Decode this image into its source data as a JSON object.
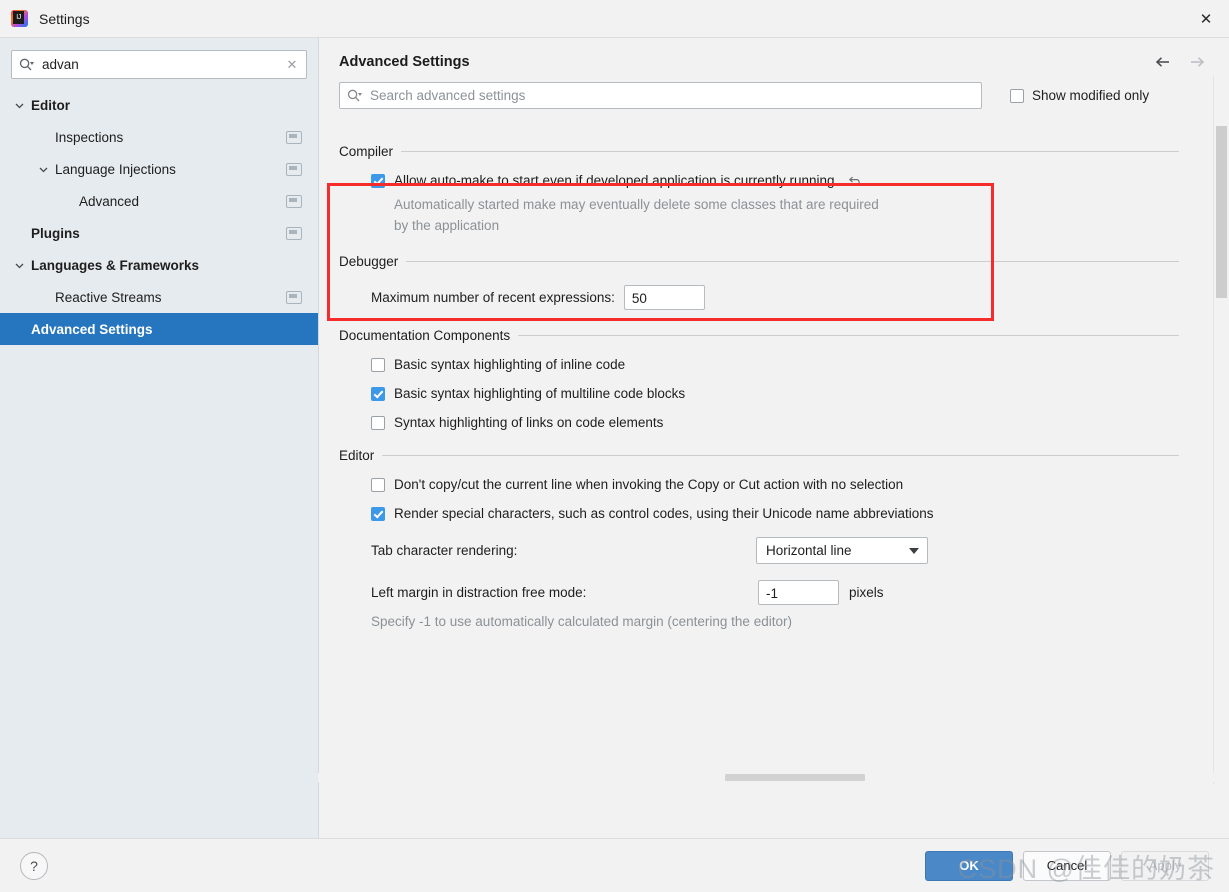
{
  "window": {
    "title": "Settings",
    "app_icon": "intellij-idea-logo",
    "close_icon": "✕"
  },
  "sidebar": {
    "search": {
      "value": "advan",
      "placeholder": "",
      "search_icon": "search-icon",
      "clear_icon": "✕"
    },
    "items": [
      {
        "label": "Editor",
        "indent": 0,
        "bold": true,
        "arrow": "chevron-down",
        "badge": false,
        "selected": false
      },
      {
        "label": "Inspections",
        "indent": 1,
        "bold": false,
        "arrow": "none",
        "badge": true,
        "selected": false
      },
      {
        "label": "Language Injections",
        "indent": 1,
        "bold": false,
        "arrow": "chevron-down",
        "badge": true,
        "selected": false
      },
      {
        "label": "Advanced",
        "indent": 2,
        "bold": false,
        "arrow": "none",
        "badge": true,
        "selected": false
      },
      {
        "label": "Plugins",
        "indent": 0,
        "bold": true,
        "arrow": "none",
        "badge": true,
        "selected": false
      },
      {
        "label": "Languages & Frameworks",
        "indent": 0,
        "bold": true,
        "arrow": "chevron-down",
        "badge": false,
        "selected": false
      },
      {
        "label": "Reactive Streams",
        "indent": 1,
        "bold": false,
        "arrow": "none",
        "badge": true,
        "selected": false
      },
      {
        "label": "Advanced Settings",
        "indent": 0,
        "bold": true,
        "arrow": "none",
        "badge": false,
        "selected": true
      }
    ]
  },
  "panel": {
    "title": "Advanced Settings",
    "back_icon": "arrow-left",
    "forward_icon": "arrow-right",
    "search": {
      "placeholder": "Search advanced settings",
      "search_icon": "search-icon"
    },
    "show_modified_only": {
      "label": "Show modified only",
      "checked": false
    }
  },
  "sections": [
    {
      "title": "Compiler",
      "highlighted": true,
      "options": [
        {
          "type": "checkbox",
          "label": "Allow auto-make to start even if developed application is currently running",
          "checked": true,
          "revert_icon": "revert-arrow-icon",
          "description": "Automatically started make may eventually delete some classes that are required by the application"
        }
      ]
    },
    {
      "title": "Debugger",
      "highlighted": false,
      "options": [
        {
          "type": "textfield",
          "label": "Maximum number of recent expressions:",
          "value": "50"
        }
      ]
    },
    {
      "title": "Documentation Components",
      "highlighted": false,
      "options": [
        {
          "type": "checkbox",
          "label": "Basic syntax highlighting of inline code",
          "checked": false
        },
        {
          "type": "checkbox",
          "label": "Basic syntax highlighting of multiline code blocks",
          "checked": true
        },
        {
          "type": "checkbox",
          "label": "Syntax highlighting of links on code elements",
          "checked": false
        }
      ]
    },
    {
      "title": "Editor",
      "highlighted": false,
      "options": [
        {
          "type": "checkbox",
          "label": "Don't copy/cut the current line when invoking the Copy or Cut action with no selection",
          "checked": false
        },
        {
          "type": "checkbox",
          "label": "Render special characters, such as control codes, using their Unicode name abbreviations",
          "checked": true
        },
        {
          "type": "combo",
          "label": "Tab character rendering:",
          "value": "Horizontal line"
        },
        {
          "type": "textfield_suffix",
          "label": "Left margin in distraction free mode:",
          "value": "-1",
          "suffix": "pixels",
          "description": "Specify -1 to use automatically calculated margin (centering the editor)"
        }
      ]
    }
  ],
  "footer": {
    "help_label": "?",
    "ok_label": "OK",
    "cancel_label": "Cancel",
    "apply_label": "Apply"
  },
  "watermark": {
    "text": "CSDN @佳佳的奶茶"
  },
  "colors": {
    "accent": "#2675bf",
    "primary_button": "#4a88c7",
    "checkbox_checked": "#3d99e8",
    "highlight_box": "#f42c2c",
    "sidebar_bg": "#e6ebef",
    "panel_bg": "#f2f2f2"
  }
}
